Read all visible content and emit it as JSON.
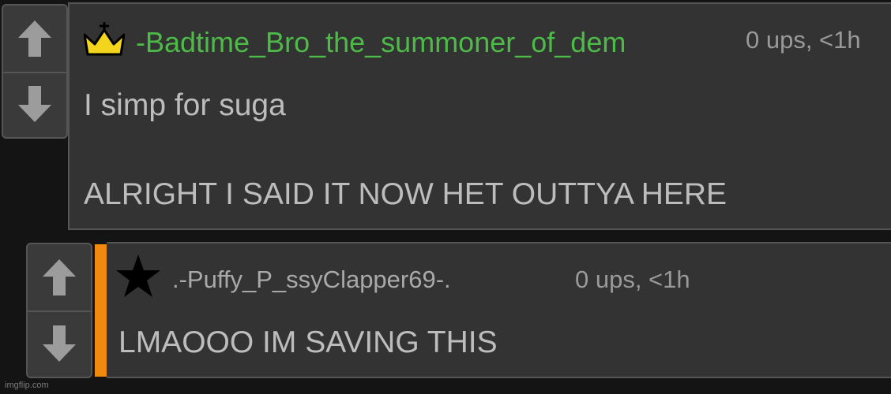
{
  "colors": {
    "background": "#141414",
    "panel": "#333333",
    "username_top": "#4cbb47",
    "username_reply": "#a9a9a9",
    "accent_bar": "#f08a0d",
    "crown": "#f2d51c",
    "star": "#000000",
    "arrow": "#9c9c9c"
  },
  "top_comment": {
    "badge_icon": "crown-icon",
    "username": "-Badtime_Bro_the_summoner_of_dem",
    "meta": "0 ups, <1h",
    "lines": [
      "I simp for suga",
      "ALRIGHT I SAID IT NOW HET OUTTYA HERE"
    ]
  },
  "reply_comment": {
    "badge_icon": "star-icon",
    "username": ".-Puffy_P_ssyClapper69-.",
    "meta": "0 ups, <1h",
    "lines": [
      "LMAOOO IM SAVING THIS"
    ]
  },
  "watermark": "imgflip.com"
}
